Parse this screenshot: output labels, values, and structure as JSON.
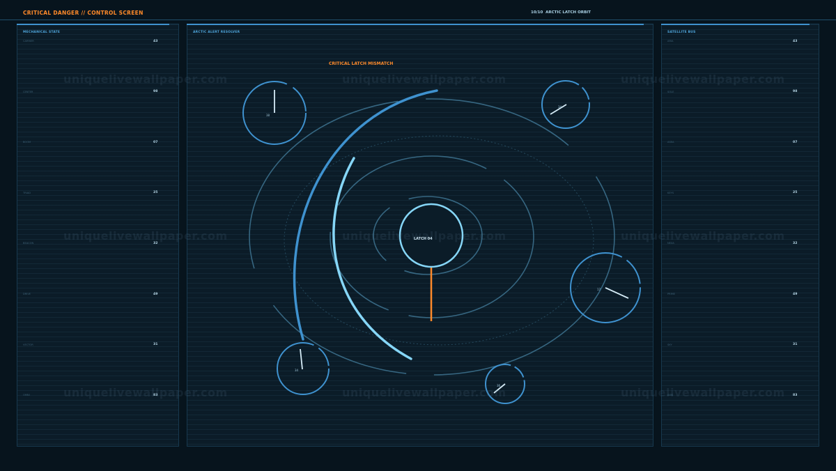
{
  "header": {
    "title": "CRITICAL DANGER // CONTROL SCREEN",
    "status": "10/10  ARCTIC LATCH ORBIT"
  },
  "left_panel": {
    "title": "MECHANICAL STATE",
    "rows": [
      {
        "label": "CARRIER",
        "value": "43"
      },
      {
        "label": "CENTER",
        "value": "98"
      },
      {
        "label": "BOOM",
        "value": "07"
      },
      {
        "label": "TRIAD",
        "value": "25"
      },
      {
        "label": "BEACON",
        "value": "32"
      },
      {
        "label": "DRIVE",
        "value": "49"
      },
      {
        "label": "VECTOR",
        "value": "31"
      },
      {
        "label": "OMNI",
        "value": "83"
      }
    ]
  },
  "center_panel": {
    "title": "ARCTIC ALERT RESOLVER",
    "warning": "CRITICAL LATCH MISMATCH",
    "core_label": "LATCH 04",
    "gauges": [
      {
        "label": "38"
      },
      {
        "label": "34"
      },
      {
        "label": "17"
      },
      {
        "label": "34"
      },
      {
        "label": "36"
      }
    ]
  },
  "right_panel": {
    "title": "SATELLITE BUS",
    "rows": [
      {
        "label": "ARIA",
        "value": "43"
      },
      {
        "label": "SOLE",
        "value": "98"
      },
      {
        "label": "ASEA",
        "value": "07"
      },
      {
        "label": "KEYS",
        "value": "25"
      },
      {
        "label": "NEXA",
        "value": "32"
      },
      {
        "label": "PRIME",
        "value": "49"
      },
      {
        "label": "SKY",
        "value": "31"
      },
      {
        "label": "AXIS",
        "value": "83"
      }
    ]
  },
  "watermark": "uniquelivewallpaper.com",
  "colors": {
    "background": "#07141d",
    "panel": "#0b1c28",
    "accent_blue": "#3f92cf",
    "light_blue": "#86d6f7",
    "alert_orange": "#ff8a2a"
  }
}
